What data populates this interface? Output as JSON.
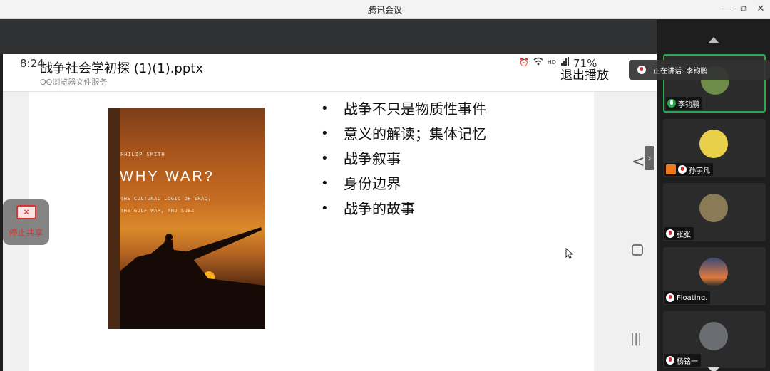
{
  "window": {
    "title": "腾讯会议",
    "minimize": "—",
    "restore": "⧉",
    "close": "✕"
  },
  "phone_status": {
    "time": "8:24",
    "icons": [
      "⏰",
      "HD"
    ],
    "battery": "71%"
  },
  "document": {
    "title": "战争社会学初探 (1)(1).pptx",
    "subtitle": "QQ浏览器文件服务",
    "exit_label": "退出播放"
  },
  "slide": {
    "book": {
      "author": "PHILIP SMITH",
      "title": "WHY WAR?",
      "subtitle_lines": [
        "THE CULTURAL LOGIC OF IRAQ,",
        "THE GULF WAR, AND SUEZ"
      ]
    },
    "bullets": [
      "战争不只是物质性事件",
      "意义的解读；集体记忆",
      "战争叙事",
      "身份边界",
      "战争的故事"
    ]
  },
  "stop_share": {
    "label": "停止共享"
  },
  "speaking_banner": {
    "text": "正在讲话: 李钧鹏"
  },
  "participants": [
    {
      "name": "李钧鹏",
      "avatar_color": "#6f8b4a",
      "active": true
    },
    {
      "name": "孙宇凡",
      "avatar_color": "#e9d04a",
      "active": false
    },
    {
      "name": "张张",
      "avatar_color": "#8a7a56",
      "active": false
    },
    {
      "name": "Floating.",
      "avatar_color": "#e07a3c",
      "active": false
    },
    {
      "name": "杨铭一",
      "avatar_color": "#6a6e72",
      "active": false
    }
  ]
}
